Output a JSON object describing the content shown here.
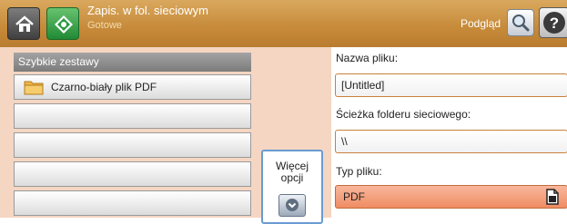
{
  "header": {
    "title": "Zapis. w fol. sieciowym",
    "status": "Gotowe",
    "preview_label": "Podgląd"
  },
  "quick_sets": {
    "header": "Szybkie zestawy",
    "items": [
      {
        "label": "Czarno-biały plik PDF"
      }
    ]
  },
  "more_options": {
    "label_line1": "Więcej",
    "label_line2": "opcji"
  },
  "settings": {
    "file_name": {
      "label": "Nazwa pliku:",
      "value": "[Untitled]"
    },
    "network_path": {
      "label": "Ścieżka folderu sieciowego:",
      "value": "\\\\"
    },
    "file_type": {
      "label": "Typ pliku:",
      "value": "PDF"
    }
  },
  "colors": {
    "header": "#c68a39",
    "panel_bg": "#f5d6c2",
    "accent_select": "#ef8c63",
    "more_border": "#6a9bd3"
  },
  "icons": {
    "home": "home-icon",
    "start": "start-icon",
    "preview": "magnifier-icon",
    "help": "help-icon",
    "folder": "folder-icon",
    "more": "chevron-down-icon",
    "select": "document-icon"
  }
}
